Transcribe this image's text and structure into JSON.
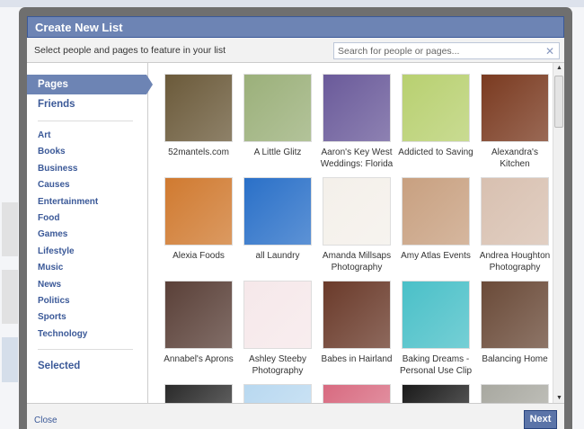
{
  "dialog": {
    "title": "Create New List",
    "subtitle": "Select people and pages to feature in your list",
    "search_placeholder": "Search for people or pages...",
    "clear_icon": "✕"
  },
  "sidebar": {
    "top": [
      {
        "label": "Pages",
        "active": true
      },
      {
        "label": "Friends"
      }
    ],
    "categories": [
      "Art",
      "Books",
      "Business",
      "Causes",
      "Entertainment",
      "Food",
      "Games",
      "Lifestyle",
      "Music",
      "News",
      "Politics",
      "Sports",
      "Technology"
    ],
    "selected": "Selected"
  },
  "tiles": [
    {
      "caption": "52mantels.com",
      "color": "#6b5a3a"
    },
    {
      "caption": "A Little Glitz",
      "color": "#9bb07a"
    },
    {
      "caption": "Aaron's Key West Weddings: Florida",
      "color": "#6a5a9a"
    },
    {
      "caption": "Addicted to Saving",
      "color": "#b8d070"
    },
    {
      "caption": "Alexandra's Kitchen",
      "color": "#7a3a20"
    },
    {
      "caption": "Alexia Foods",
      "color": "#d07a30"
    },
    {
      "caption": "all Laundry",
      "color": "#2a70c8"
    },
    {
      "caption": "Amanda Millsaps Photography",
      "color": "#f4f0ea"
    },
    {
      "caption": "Amy Atlas Events",
      "color": "#c8a080"
    },
    {
      "caption": "Andrea Houghton Photography",
      "color": "#d8c0b0"
    },
    {
      "caption": "Annabel's Aprons",
      "color": "#5a4038"
    },
    {
      "caption": "Ashley Steeby Photography",
      "color": "#f6e8ea"
    },
    {
      "caption": "Babes in Hairland",
      "color": "#6a3a2a"
    },
    {
      "caption": "Baking Dreams - Personal Use Clip",
      "color": "#4ac0c8"
    },
    {
      "caption": "Balancing Home",
      "color": "#6a4a38"
    },
    {
      "caption": "",
      "color": "#2a2a2a"
    },
    {
      "caption": "",
      "color": "#b8d8f0"
    },
    {
      "caption": "",
      "color": "#d86a80"
    },
    {
      "caption": "",
      "color": "#1a1a1a"
    },
    {
      "caption": "",
      "color": "#a8a8a0"
    }
  ],
  "footer": {
    "close": "Close",
    "next": "Next"
  },
  "scrollbar": {
    "up": "▲",
    "down": "▼"
  }
}
